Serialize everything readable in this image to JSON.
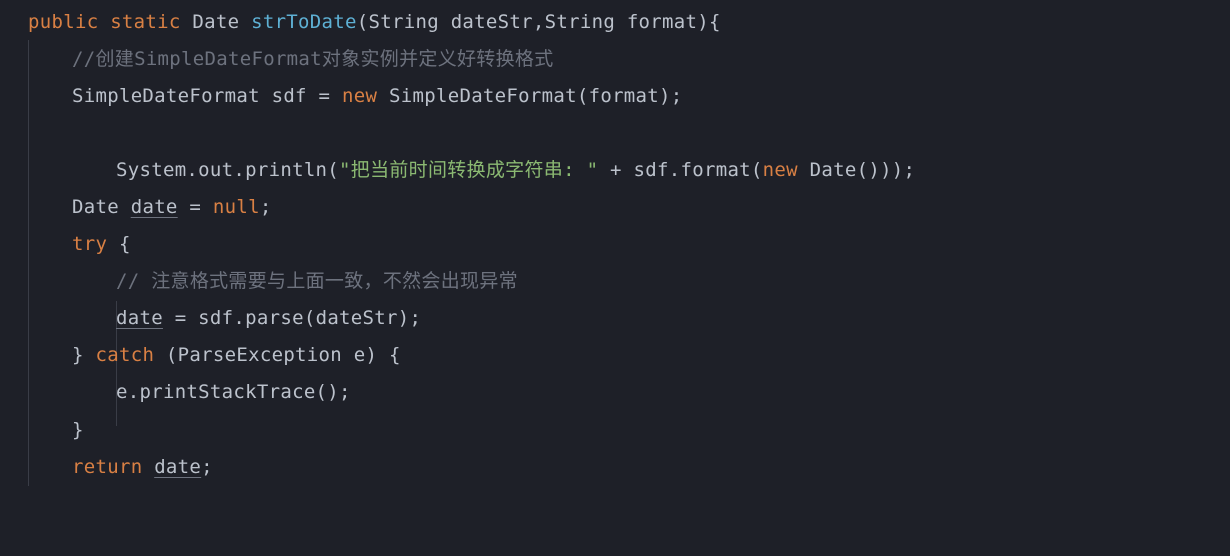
{
  "code": {
    "line1": {
      "kw_public": "public",
      "kw_static": "static",
      "return_type": "Date",
      "method_name": "strToDate",
      "param1_type": "String",
      "param1_name": "dateStr",
      "param2_type": "String",
      "param2_name": "format",
      "brace": "){"
    },
    "line2": {
      "comment": "//创建SimpleDateFormat对象实例并定义好转换格式"
    },
    "line3": {
      "type": "SimpleDateFormat",
      "var": "sdf",
      "eq": "=",
      "kw_new": "new",
      "ctor": "SimpleDateFormat",
      "arg": "format",
      "end": ");"
    },
    "line5": {
      "prefix": "System.out.println(",
      "string": "\"把当前时间转换成字符串: \"",
      "plus": " + sdf.format(",
      "kw_new": "new",
      "ctor": " Date()));"
    },
    "line6": {
      "type": "Date",
      "var": "date",
      "eq": " = ",
      "kw_null": "null",
      "end": ";"
    },
    "line7": {
      "kw_try": "try",
      "brace": " {"
    },
    "line8": {
      "comment": "// 注意格式需要与上面一致，不然会出现异常"
    },
    "line9": {
      "var": "date",
      "rest": " = sdf.parse(dateStr);"
    },
    "line10": {
      "close": "} ",
      "kw_catch": "catch",
      "params": " (ParseException e) {"
    },
    "line11": {
      "stmt": "e.printStackTrace();"
    },
    "line12": {
      "close": "}"
    },
    "line13": {
      "kw_return": "return",
      "sp": " ",
      "var": "date",
      "end": ";"
    }
  }
}
